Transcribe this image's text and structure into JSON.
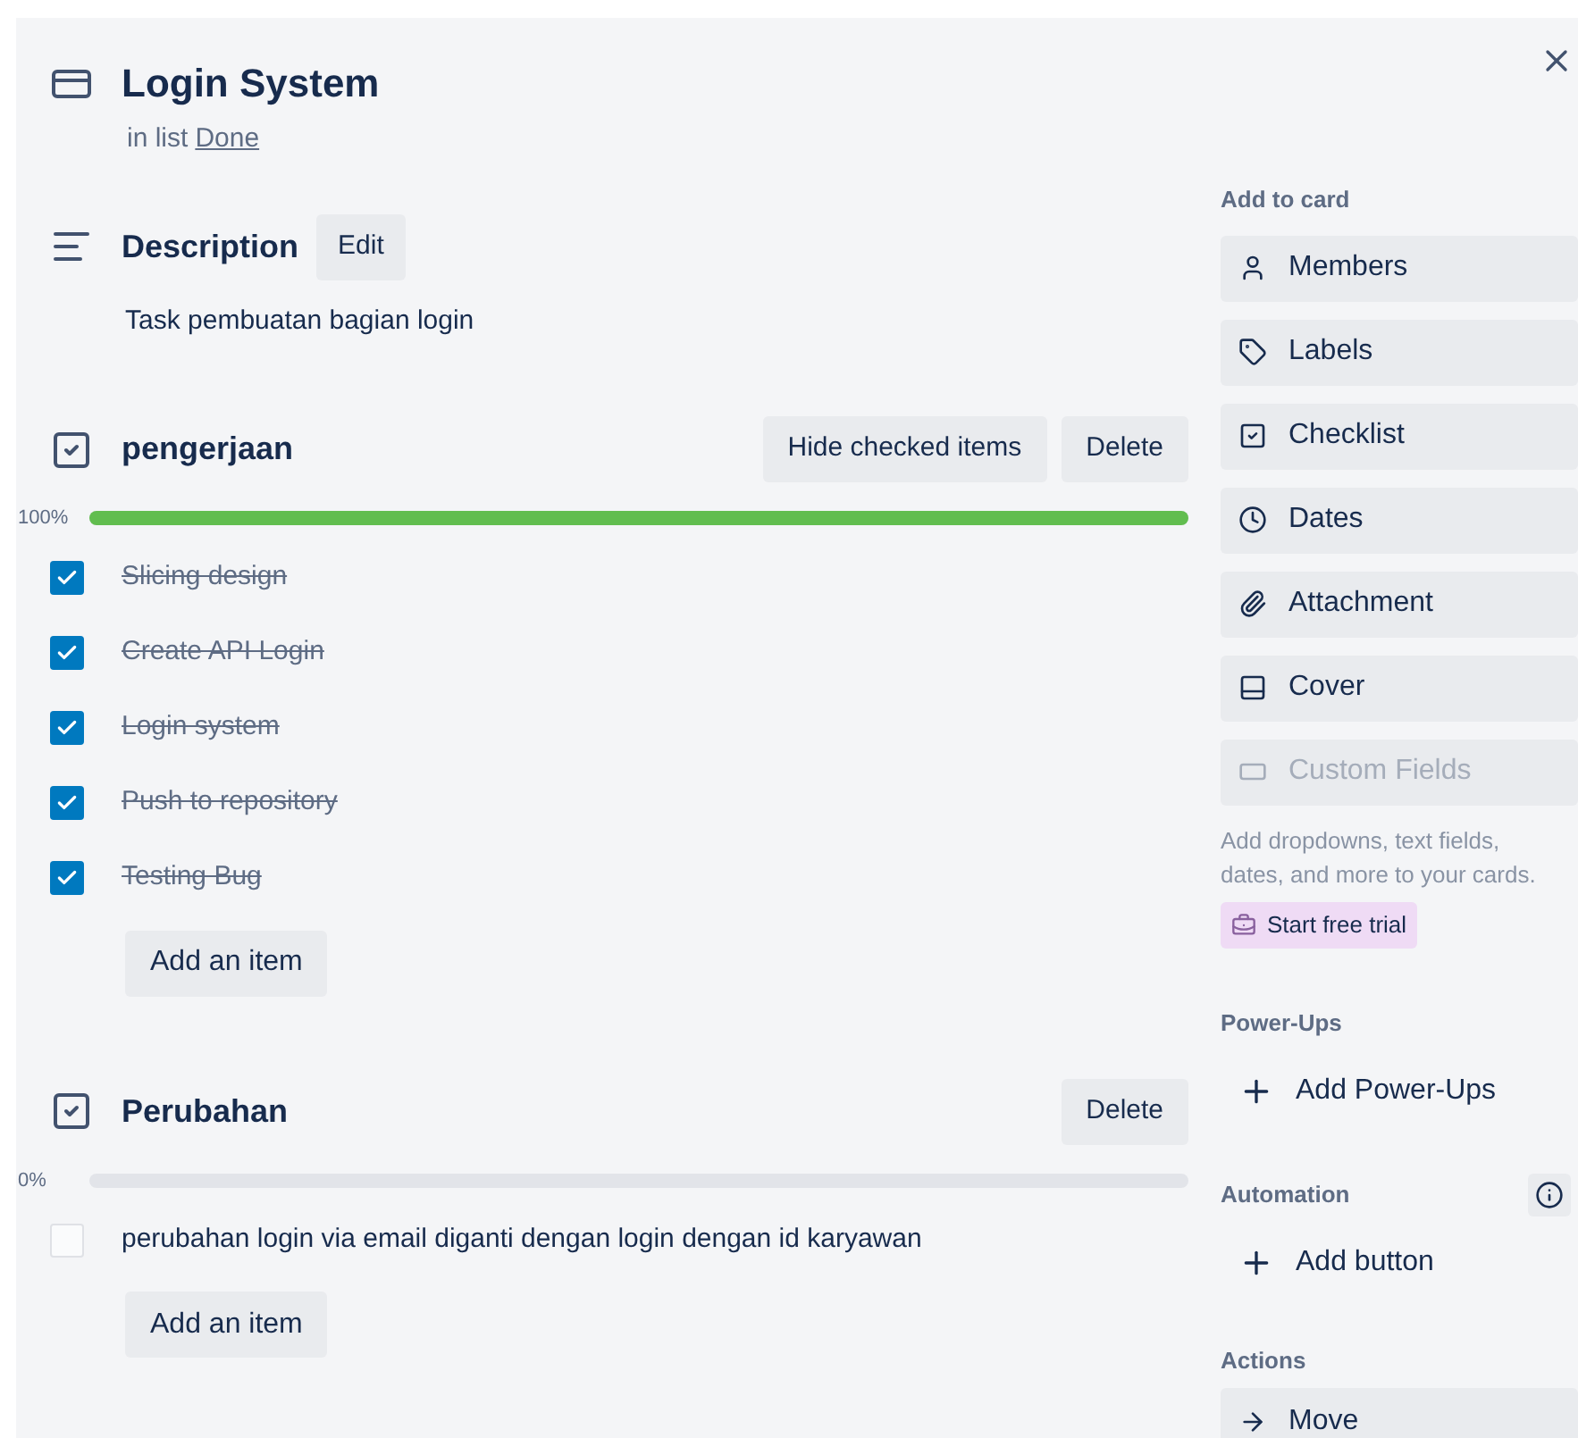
{
  "card": {
    "title": "Login System",
    "list_prefix": "in list",
    "list_name": "Done"
  },
  "description": {
    "heading": "Description",
    "edit_button": "Edit",
    "text": "Task pembuatan bagian login"
  },
  "checklists": [
    {
      "title": "pengerjaan",
      "hide_button": "Hide checked items",
      "delete_button": "Delete",
      "percent": "100%",
      "level": 1,
      "add_button": "Add an item",
      "items": [
        {
          "text": "Slicing design",
          "checked": true
        },
        {
          "text": "Create API Login",
          "checked": true
        },
        {
          "text": "Login system",
          "checked": true
        },
        {
          "text": "Push to repository",
          "checked": true
        },
        {
          "text": "Testing Bug",
          "checked": true
        }
      ]
    },
    {
      "title": "Perubahan",
      "delete_button": "Delete",
      "percent": "0%",
      "level": 0,
      "add_button": "Add an item",
      "items": [
        {
          "text": "perubahan login via email diganti dengan login dengan id karyawan",
          "checked": false
        }
      ]
    }
  ],
  "sidebar": [
    {
      "heading": "Add to card",
      "items": [
        {
          "kind": "button",
          "label": "Members",
          "disabled": false
        },
        {
          "kind": "button",
          "label": "Labels",
          "disabled": false
        },
        {
          "kind": "button",
          "label": "Checklist",
          "disabled": false
        },
        {
          "kind": "button",
          "label": "Dates",
          "disabled": false
        },
        {
          "kind": "button",
          "label": "Attachment",
          "disabled": false
        },
        {
          "kind": "button",
          "label": "Cover",
          "disabled": false
        },
        {
          "kind": "button",
          "label": "Custom Fields",
          "disabled": true
        }
      ],
      "note": "Add dropdowns, text fields, dates, and more to your cards.",
      "trial_button": "Start free trial"
    },
    {
      "heading": "Power-Ups",
      "items": [
        {
          "kind": "add",
          "label": "Add Power-Ups",
          "disabled": false
        }
      ]
    },
    {
      "heading": "Automation",
      "info": true,
      "items": [
        {
          "kind": "add",
          "label": "Add button",
          "disabled": false
        }
      ]
    },
    {
      "heading": "Actions",
      "items": [
        {
          "kind": "button",
          "label": "Move",
          "disabled": false
        }
      ]
    }
  ]
}
